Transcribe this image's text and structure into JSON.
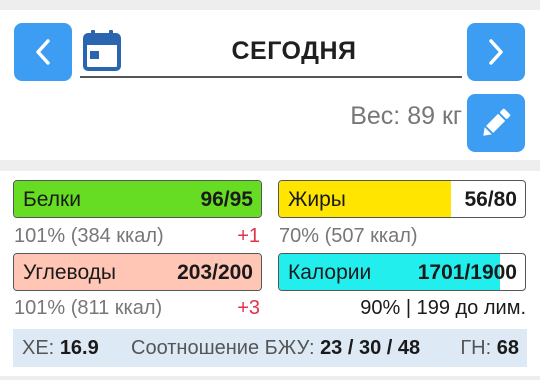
{
  "header": {
    "date_title": "СЕГОДНЯ",
    "weight_text": "Вес: 89 кг"
  },
  "nutrients": {
    "protein": {
      "label": "Белки",
      "value": "96/95",
      "percent_text": "101% (384 ккал)",
      "delta": "+1",
      "color": "#66dd22",
      "fill_fraction": 1.0
    },
    "fat": {
      "label": "Жиры",
      "value": "56/80",
      "percent_text": "70% (507 ккал)",
      "color": "#ffe500",
      "fill_fraction": 0.7
    },
    "carbs": {
      "label": "Углеводы",
      "value": "203/200",
      "percent_text": "101% (811 ккал)",
      "delta": "+3",
      "color": "#ffc5b5",
      "fill_fraction": 1.0
    },
    "calories": {
      "label": "Калории",
      "value": "1701/1900",
      "remaining_text": "90% | 199 до лим.",
      "color": "#22eeee",
      "fill_fraction": 0.9
    }
  },
  "stats": {
    "xe_label": "ХЕ:",
    "xe_value": "16.9",
    "ratio_label": "Соотношение БЖУ:",
    "ratio_value": "23 / 30 / 48",
    "gi_label": "ГН:",
    "gi_value": "68"
  },
  "colors": {
    "accent": "#3d9df2"
  },
  "icons": {
    "prev": "chevron-left-icon",
    "next": "chevron-right-icon",
    "calendar": "calendar-icon",
    "edit": "pencil-icon"
  }
}
